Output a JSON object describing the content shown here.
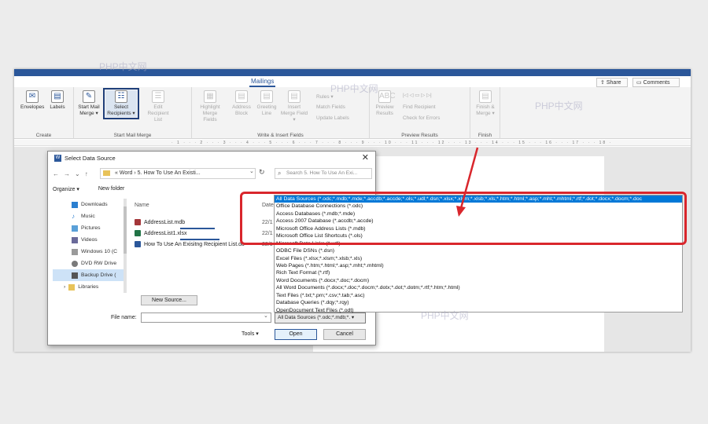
{
  "ribbon": {
    "active_tab": "Mailings",
    "share_label": "Share",
    "comments_label": "Comments",
    "groups": {
      "create": "Create",
      "start_mail_merge": "Start Mail Merge",
      "write_insert": "Write & Insert Fields",
      "preview": "Preview Results",
      "finish": "Finish"
    },
    "buttons": {
      "envelopes": "Envelopes",
      "labels": "Labels",
      "start_mail_merge": "Start Mail Merge ▾",
      "select_recipients": "Select Recipients ▾",
      "edit_recipient_list": "Edit Recipient List",
      "highlight_merge_fields": "Highlight Merge Fields",
      "address_block": "Address Block",
      "greeting_line": "Greeting Line",
      "insert_merge_field": "Insert Merge Field ▾",
      "rules": "Rules ▾",
      "match_fields": "Match Fields",
      "update_labels": "Update Labels",
      "preview_results": "Preview Results",
      "find_recipient": "Find Recipient",
      "check_for_errors": "Check for Errors",
      "finish_merge": "Finish & Merge ▾"
    }
  },
  "dialog": {
    "title": "Select Data Source",
    "close": "✕",
    "path": "«  Word  ›  5. How To Use An Existi...",
    "search_placeholder": "Search 5. How To Use An Exi...",
    "organize": "Organize ▾",
    "new_folder": "New folder",
    "columns": {
      "name": "Name",
      "date": "Date"
    },
    "nav_items": [
      "Downloads",
      "Music",
      "Pictures",
      "Videos",
      "Windows 10 (C",
      "DVD RW Drive",
      "Backup Drive (",
      "Libraries"
    ],
    "files": [
      {
        "name": "AddressList.mdb",
        "date": "22/1"
      },
      {
        "name": "AddressList1.xlsx",
        "date": "22/1"
      },
      {
        "name": "How To Use An Exisitng Recipient List.do",
        "date": "22/1"
      }
    ],
    "new_source": "New Source...",
    "file_name_label": "File name:",
    "file_name_value": "",
    "tools": "Tools",
    "file_type_selected": "All Data Sources (*.odc;*.mdb;*.",
    "open": "Open",
    "cancel": "Cancel"
  },
  "dropdown_options": [
    "All Data Sources (*.odc;*.mdb;*.mde;*.accdb;*.accde;*.ols;*.udl;*.dsn;*.xlsx;*.xlsm;*.xlsb;*.xls;*.htm;*.html;*.asp;*.mht;*.mhtml;*.rtf;*.dot;*.docx;*.docm;*.doc",
    "Office Database Connections (*.odc)",
    "Access Databases (*.mdb;*.mde)",
    "Access 2007 Database (*.accdb;*.accde)",
    "Microsoft Office Address Lists (*.mdb)",
    "Microsoft Office List Shortcuts (*.ols)",
    "Microsoft Data Links (*.udl)",
    "ODBC File DSNs (*.dsn)",
    "Excel Files (*.xlsx;*.xlsm;*.xlsb;*.xls)",
    "Web Pages (*.htm;*.html;*.asp;*.mht;*.mhtml)",
    "Rich Text Format (*.rtf)",
    "Word Documents (*.docx;*.doc;*.docm)",
    "All Word Documents (*.docx;*.doc;*.docm;*.dotx;*.dot;*.dotm;*.rtf;*.htm;*.html)",
    "Text Files (*.txt;*.prn;*.csv;*.tab;*.asc)",
    "Database Queries (*.dqy;*.rqy)",
    "OpenDocument Text Files (*.odt)"
  ],
  "watermark": "PHP中文网",
  "colors": {
    "accent": "#2b579a",
    "highlight": "#d9262c",
    "selection": "#0078d7"
  }
}
